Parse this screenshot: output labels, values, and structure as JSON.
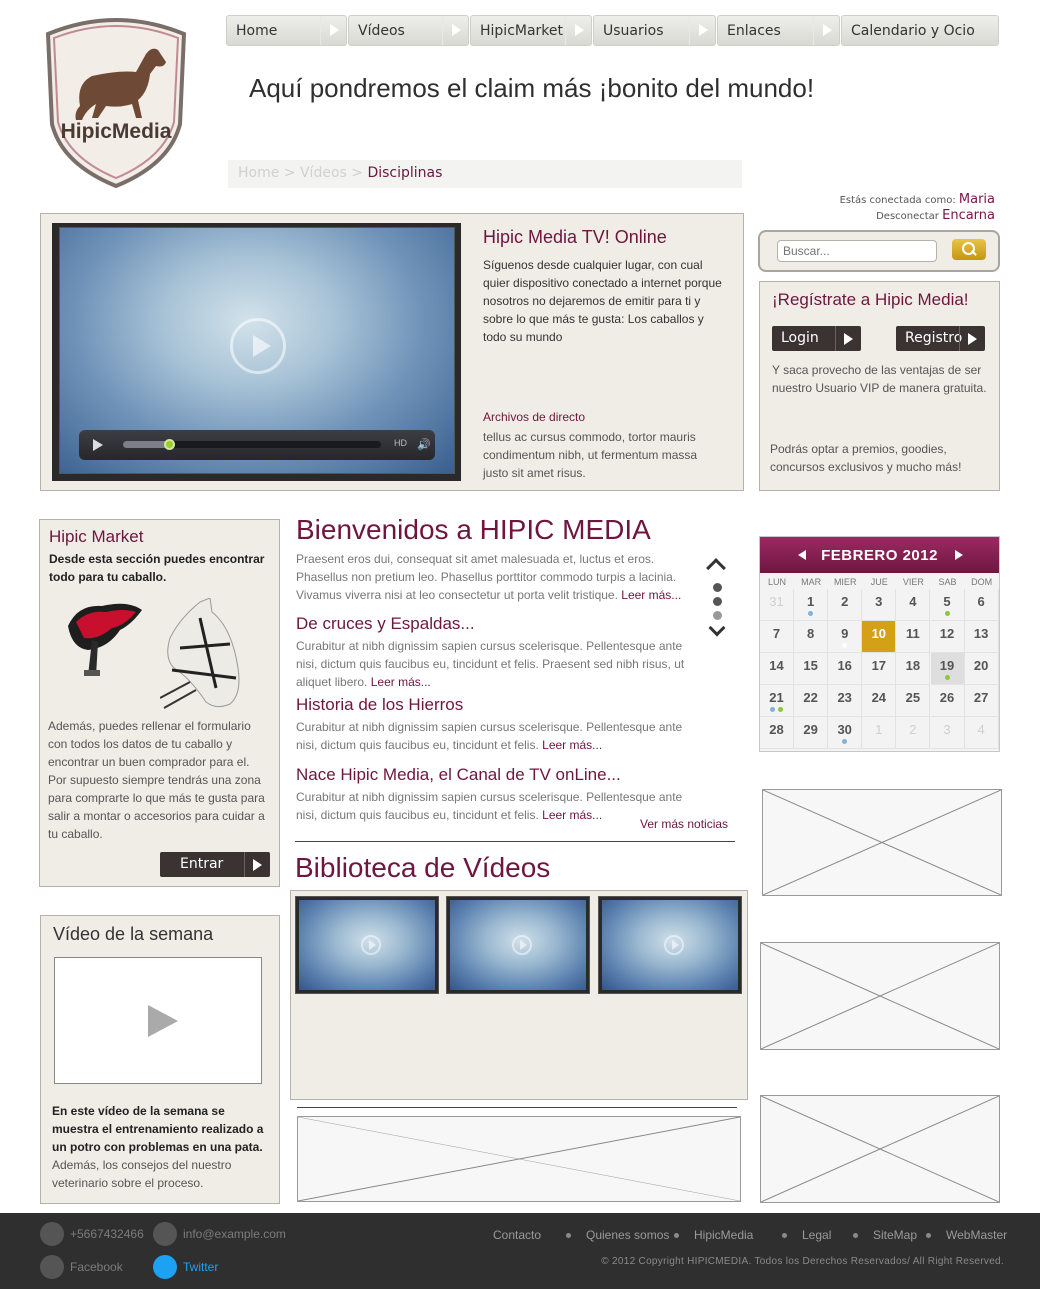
{
  "brand": {
    "logo_text": "HipicMedia",
    "claim": "Aquí pondremos el claim más ¡bonito del mundo!"
  },
  "nav": [
    {
      "label": "Home"
    },
    {
      "label": "Vídeos"
    },
    {
      "label": "HipicMarket"
    },
    {
      "label": "Usuarios"
    },
    {
      "label": "Enlaces"
    },
    {
      "label": "Calendario y Ocio"
    }
  ],
  "breadcrumb": {
    "items": [
      "Home",
      "Vídeos"
    ],
    "separator": ">",
    "current": "Disciplinas"
  },
  "session": {
    "connected_label": "Estás conectada como:",
    "logout_label": "Desconectar",
    "user_first": "Maria",
    "user_last": "Encarna"
  },
  "tv": {
    "title": "Hipic Media TV! Online",
    "text": "Síguenos desde cualquier lugar, con cual quier dispositivo conectado a internet porque nosotros no dejaremos de emitir para ti y sobre lo que más te gusta: Los caballos y todo su mundo",
    "link": "Archivos de directo",
    "text2": "tellus ac cursus commodo, tortor mauris condimentum nibh, ut fermentum massa justo sit amet risus.",
    "player": {
      "hd_label": "HD",
      "progress": 0.18
    }
  },
  "search": {
    "placeholder": "Buscar..."
  },
  "register": {
    "title": "¡Regístrate a Hipic Media!",
    "login_label": "Login",
    "register_label": "Registro",
    "text": "Y saca provecho de las ventajas de ser nuestro Usuario VIP de manera gratuita.",
    "text2": "Podrás optar a premios, goodies, concursos exclusivos y mucho más!"
  },
  "market": {
    "title": "Hipic Market",
    "subtitle": "Desde esta sección puedes encontrar todo para tu caballo.",
    "text": "Además, puedes rellenar el formulario con todos los datos de tu caballo y encontrar un buen comprador para el. Por supuesto siempre tendrás una zona para comprarte lo que más te gusta para salir a montar o accesorios para cuidar a tu caballo.",
    "button": "Entrar"
  },
  "video_semana": {
    "title": "Vídeo de la semana",
    "bold_text": "En este vídeo de la semana se muestra el entrenamiento realizado a un potro con problemas en una pata.",
    "text": " Además, los consejos del nuestro veterinario sobre el proceso."
  },
  "welcome": {
    "title": "Bienvenidos a HIPIC MEDIA"
  },
  "news": [
    {
      "title": "",
      "text": "Praesent eros dui, consequat sit amet malesuada et, luctus et eros. Phasellus non pretium leo. Phasellus porttitor commodo turpis a lacinia. Vivamus viverra nisi at leo consectetur ut porta velit tristique.",
      "more": "Leer más..."
    },
    {
      "title": "De cruces y Espaldas...",
      "text": "Curabitur at nibh dignissim sapien cursus scelerisque. Pellentesque ante nisi, dictum quis faucibus eu, tincidunt et felis. Praesent sed nibh risus, ut aliquet libero.",
      "more": "Leer más..."
    },
    {
      "title": "Historia de los Hierros",
      "text": "Curabitur at nibh dignissim sapien cursus scelerisque. Pellentesque ante nisi, dictum quis faucibus eu, tincidunt et felis.",
      "more": "Leer más..."
    },
    {
      "title": "Nace Hipic Media, el Canal de TV onLine...",
      "text": "Curabitur at nibh dignissim sapien cursus scelerisque. Pellentesque ante nisi, dictum quis faucibus eu, tincidunt et felis.",
      "more": "Leer más..."
    }
  ],
  "news_more": "Ver más noticias",
  "biblioteca": {
    "title": "Biblioteca de Vídeos"
  },
  "calendar": {
    "month": "FEBRERO 2012",
    "dow": [
      "LUN",
      "MAR",
      "MIER",
      "JUE",
      "VIER",
      "SAB",
      "DOM"
    ],
    "days": [
      "31",
      "1",
      "2",
      "3",
      "4",
      "5",
      "6",
      "7",
      "8",
      "9",
      "10",
      "11",
      "12",
      "13",
      "14",
      "15",
      "16",
      "17",
      "18",
      "19",
      "20",
      "21",
      "22",
      "23",
      "24",
      "25",
      "26",
      "27",
      "28",
      "29",
      "30",
      "1",
      "2",
      "3",
      "4"
    ],
    "today": "10",
    "event_colors": {
      "blue": "#7fb2dd",
      "green": "#8cc63f",
      "white": "#ffffff"
    }
  },
  "footer": {
    "phone": "+5667432466",
    "email": "info@example.com",
    "facebook": "Facebook",
    "twitter": "Twitter",
    "links": [
      "Contacto",
      "Quienes somos",
      "HipicMedia",
      "Legal",
      "SiteMap",
      "WebMaster"
    ],
    "copyright": "© 2012 Copyright HIPICMEDIA. Todos los Derechos Reservados/ All Right Reserved."
  },
  "colors": {
    "maroon": "#6e1640",
    "panel": "#f0ede6",
    "gold": "#d4a017",
    "footer": "#2f2f2f"
  }
}
